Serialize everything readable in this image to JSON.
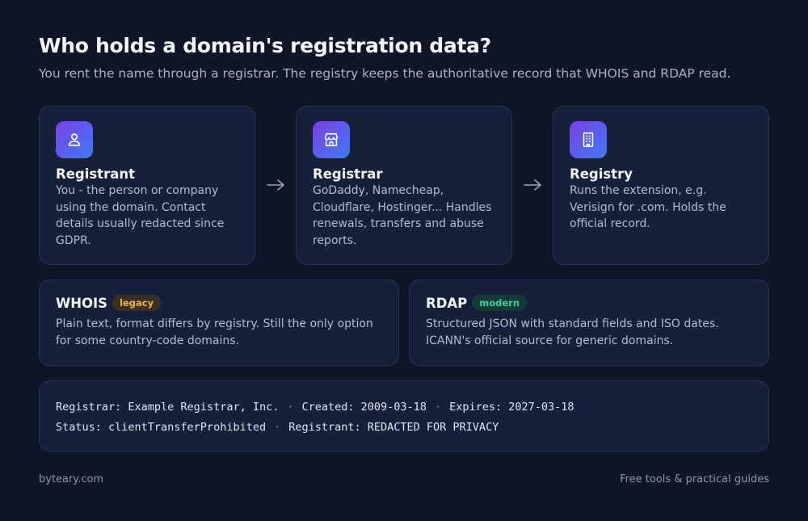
{
  "header": {
    "title": "Who holds a domain's registration data?",
    "subtitle": "You rent the name through a registrar. The registry keeps the authoritative record that WHOIS and RDAP read."
  },
  "roles": [
    {
      "name": "Registrant",
      "icon": "person-icon",
      "description": "You - the person or company using the domain. Contact details usually redacted since GDPR."
    },
    {
      "name": "Registrar",
      "icon": "storefront-icon",
      "description": "GoDaddy, Namecheap, Cloudflare, Hostinger... Handles renewals, transfers and abuse reports."
    },
    {
      "name": "Registry",
      "icon": "building-icon",
      "description": "Runs the extension, e.g. Verisign for .com. Holds the official record."
    }
  ],
  "protocols": {
    "whois": {
      "name": "WHOIS",
      "badge": "legacy",
      "description": "Plain text, format differs by registry. Still the only option for some country-code domains."
    },
    "rdap": {
      "name": "RDAP",
      "badge": "modern",
      "description": "Structured JSON with standard fields and ISO dates. ICANN's official source for generic domains."
    }
  },
  "record": {
    "separator": "·",
    "line1": [
      "Registrar: Example Registrar, Inc.",
      "Created: 2009-03-18",
      "Expires: 2027-03-18"
    ],
    "line2": [
      "Status: clientTransferProhibited",
      "Registrant: REDACTED FOR PRIVACY"
    ]
  },
  "footer": {
    "left": "byteary.com",
    "right": "Free tools & practical guides"
  },
  "colors": {
    "background": "#0f1628",
    "card": "#17203a",
    "icon_gradient_start": "#7b3fe4",
    "icon_gradient_end": "#3d7bf5",
    "legacy_badge": "#f0b63a",
    "modern_badge": "#36d39a"
  }
}
